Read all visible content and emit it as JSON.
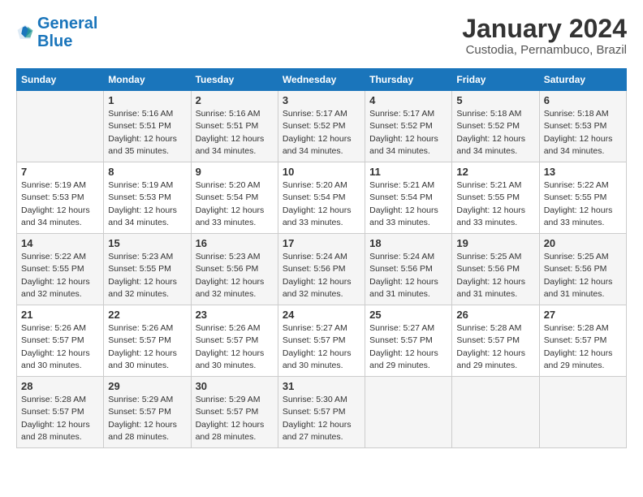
{
  "logo": {
    "line1": "General",
    "line2": "Blue"
  },
  "header": {
    "month": "January 2024",
    "location": "Custodia, Pernambuco, Brazil"
  },
  "weekdays": [
    "Sunday",
    "Monday",
    "Tuesday",
    "Wednesday",
    "Thursday",
    "Friday",
    "Saturday"
  ],
  "weeks": [
    [
      {
        "day": null,
        "info": null
      },
      {
        "day": "1",
        "info": "Sunrise: 5:16 AM\nSunset: 5:51 PM\nDaylight: 12 hours\nand 35 minutes."
      },
      {
        "day": "2",
        "info": "Sunrise: 5:16 AM\nSunset: 5:51 PM\nDaylight: 12 hours\nand 34 minutes."
      },
      {
        "day": "3",
        "info": "Sunrise: 5:17 AM\nSunset: 5:52 PM\nDaylight: 12 hours\nand 34 minutes."
      },
      {
        "day": "4",
        "info": "Sunrise: 5:17 AM\nSunset: 5:52 PM\nDaylight: 12 hours\nand 34 minutes."
      },
      {
        "day": "5",
        "info": "Sunrise: 5:18 AM\nSunset: 5:52 PM\nDaylight: 12 hours\nand 34 minutes."
      },
      {
        "day": "6",
        "info": "Sunrise: 5:18 AM\nSunset: 5:53 PM\nDaylight: 12 hours\nand 34 minutes."
      }
    ],
    [
      {
        "day": "7",
        "info": "Sunrise: 5:19 AM\nSunset: 5:53 PM\nDaylight: 12 hours\nand 34 minutes."
      },
      {
        "day": "8",
        "info": "Sunrise: 5:19 AM\nSunset: 5:53 PM\nDaylight: 12 hours\nand 34 minutes."
      },
      {
        "day": "9",
        "info": "Sunrise: 5:20 AM\nSunset: 5:54 PM\nDaylight: 12 hours\nand 33 minutes."
      },
      {
        "day": "10",
        "info": "Sunrise: 5:20 AM\nSunset: 5:54 PM\nDaylight: 12 hours\nand 33 minutes."
      },
      {
        "day": "11",
        "info": "Sunrise: 5:21 AM\nSunset: 5:54 PM\nDaylight: 12 hours\nand 33 minutes."
      },
      {
        "day": "12",
        "info": "Sunrise: 5:21 AM\nSunset: 5:55 PM\nDaylight: 12 hours\nand 33 minutes."
      },
      {
        "day": "13",
        "info": "Sunrise: 5:22 AM\nSunset: 5:55 PM\nDaylight: 12 hours\nand 33 minutes."
      }
    ],
    [
      {
        "day": "14",
        "info": "Sunrise: 5:22 AM\nSunset: 5:55 PM\nDaylight: 12 hours\nand 32 minutes."
      },
      {
        "day": "15",
        "info": "Sunrise: 5:23 AM\nSunset: 5:55 PM\nDaylight: 12 hours\nand 32 minutes."
      },
      {
        "day": "16",
        "info": "Sunrise: 5:23 AM\nSunset: 5:56 PM\nDaylight: 12 hours\nand 32 minutes."
      },
      {
        "day": "17",
        "info": "Sunrise: 5:24 AM\nSunset: 5:56 PM\nDaylight: 12 hours\nand 32 minutes."
      },
      {
        "day": "18",
        "info": "Sunrise: 5:24 AM\nSunset: 5:56 PM\nDaylight: 12 hours\nand 31 minutes."
      },
      {
        "day": "19",
        "info": "Sunrise: 5:25 AM\nSunset: 5:56 PM\nDaylight: 12 hours\nand 31 minutes."
      },
      {
        "day": "20",
        "info": "Sunrise: 5:25 AM\nSunset: 5:56 PM\nDaylight: 12 hours\nand 31 minutes."
      }
    ],
    [
      {
        "day": "21",
        "info": "Sunrise: 5:26 AM\nSunset: 5:57 PM\nDaylight: 12 hours\nand 30 minutes."
      },
      {
        "day": "22",
        "info": "Sunrise: 5:26 AM\nSunset: 5:57 PM\nDaylight: 12 hours\nand 30 minutes."
      },
      {
        "day": "23",
        "info": "Sunrise: 5:26 AM\nSunset: 5:57 PM\nDaylight: 12 hours\nand 30 minutes."
      },
      {
        "day": "24",
        "info": "Sunrise: 5:27 AM\nSunset: 5:57 PM\nDaylight: 12 hours\nand 30 minutes."
      },
      {
        "day": "25",
        "info": "Sunrise: 5:27 AM\nSunset: 5:57 PM\nDaylight: 12 hours\nand 29 minutes."
      },
      {
        "day": "26",
        "info": "Sunrise: 5:28 AM\nSunset: 5:57 PM\nDaylight: 12 hours\nand 29 minutes."
      },
      {
        "day": "27",
        "info": "Sunrise: 5:28 AM\nSunset: 5:57 PM\nDaylight: 12 hours\nand 29 minutes."
      }
    ],
    [
      {
        "day": "28",
        "info": "Sunrise: 5:28 AM\nSunset: 5:57 PM\nDaylight: 12 hours\nand 28 minutes."
      },
      {
        "day": "29",
        "info": "Sunrise: 5:29 AM\nSunset: 5:57 PM\nDaylight: 12 hours\nand 28 minutes."
      },
      {
        "day": "30",
        "info": "Sunrise: 5:29 AM\nSunset: 5:57 PM\nDaylight: 12 hours\nand 28 minutes."
      },
      {
        "day": "31",
        "info": "Sunrise: 5:30 AM\nSunset: 5:57 PM\nDaylight: 12 hours\nand 27 minutes."
      },
      {
        "day": null,
        "info": null
      },
      {
        "day": null,
        "info": null
      },
      {
        "day": null,
        "info": null
      }
    ]
  ]
}
